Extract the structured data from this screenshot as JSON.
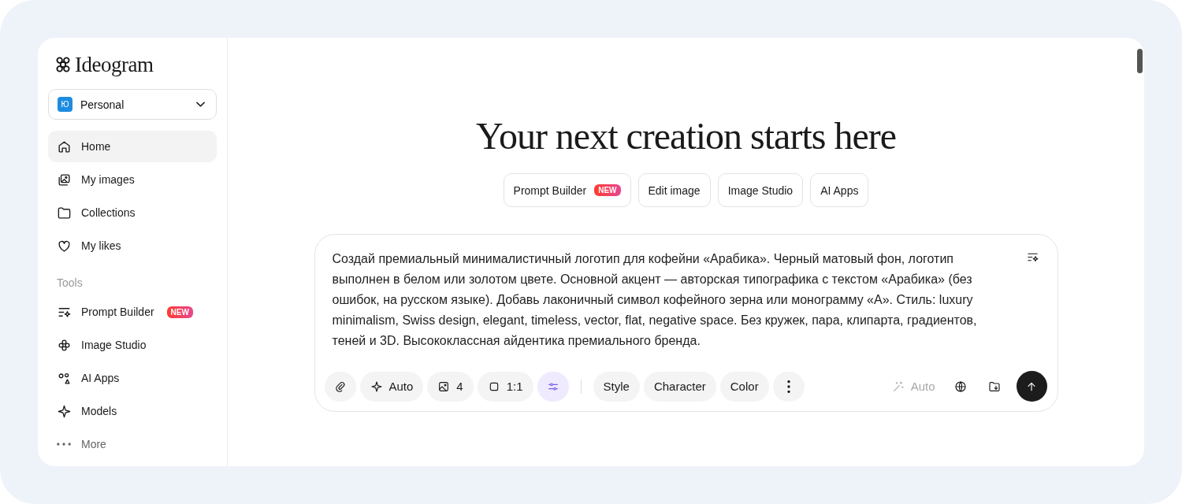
{
  "logo": {
    "text": "Ideogram"
  },
  "workspace": {
    "avatar": "Ю",
    "name": "Personal"
  },
  "nav": [
    {
      "kind": "home",
      "label": "Home",
      "selected": true
    },
    {
      "kind": "images",
      "label": "My images",
      "selected": false
    },
    {
      "kind": "folder",
      "label": "Collections",
      "selected": false
    },
    {
      "kind": "heart",
      "label": "My likes",
      "selected": false
    }
  ],
  "tools": {
    "title": "Tools",
    "items": [
      {
        "kind": "builder",
        "label": "Prompt Builder",
        "badge": "NEW",
        "selected": false
      },
      {
        "kind": "studio",
        "label": "Image Studio",
        "selected": false
      },
      {
        "kind": "apps",
        "label": "AI Apps",
        "selected": false
      },
      {
        "kind": "models",
        "label": "Models",
        "selected": false
      },
      {
        "kind": "more",
        "label": "More",
        "selected": false
      }
    ]
  },
  "heading": "Your next creation starts here",
  "quick_actions": [
    {
      "label": "Prompt Builder",
      "badge": "NEW"
    },
    {
      "label": "Edit image"
    },
    {
      "label": "Image Studio"
    },
    {
      "label": "AI Apps"
    }
  ],
  "prompt": {
    "value": "Создай премиальный минималистичный логотип для кофейни «Арабика». Черный матовый фон, логотип выполнен в белом или золотом цвете. Основной акцент — авторская типографика с текстом «Арабика» (без ошибок, на русском языке). Добавь лаконичный символ кофейного зерна или монограмму «А». Стиль: luxury minimalism, Swiss design, elegant, timeless, vector, flat, negative space. Без кружек, пара, клипарта, градиентов, теней и 3D. Высококлассная айдентика премиального бренда."
  },
  "toolbar": [
    {
      "kind": "attach"
    },
    {
      "kind": "magic",
      "label": "Auto"
    },
    {
      "kind": "count",
      "label": "4"
    },
    {
      "kind": "ratio",
      "label": "1:1"
    },
    {
      "kind": "settings",
      "on": true
    },
    {
      "kind": "divider"
    },
    {
      "kind": "plain",
      "label": "Style"
    },
    {
      "kind": "plain",
      "label": "Character"
    },
    {
      "kind": "plain",
      "label": "Color"
    },
    {
      "kind": "more"
    }
  ],
  "toolbar_right": [
    {
      "kind": "wand",
      "label": "Auto",
      "disabled": true
    },
    {
      "kind": "globe"
    },
    {
      "kind": "folder"
    },
    {
      "kind": "submit"
    }
  ]
}
